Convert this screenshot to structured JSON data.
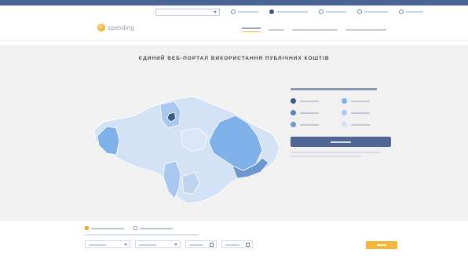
{
  "topbar": {
    "text": ""
  },
  "subnav": {
    "select_label": "",
    "items": [
      {
        "icon": "info-icon",
        "label": ""
      },
      {
        "icon": "user-icon",
        "label": ""
      },
      {
        "icon": "chart-icon",
        "label": ""
      },
      {
        "icon": "list-icon",
        "label": ""
      },
      {
        "icon": "help-icon",
        "label": ""
      }
    ]
  },
  "brand": {
    "name": "spending"
  },
  "mainnav": {
    "items": [
      "",
      "",
      "",
      ""
    ]
  },
  "hero": {
    "title": "ЄДИНИЙ ВЕБ-ПОРТАЛ ВИКОРИСТАННЯ ПУБЛІЧНИХ КОШТІВ"
  },
  "legend": {
    "title": "",
    "items": [
      {
        "color": "#3d5a8c",
        "label": ""
      },
      {
        "color": "#7fb0e8",
        "label": ""
      },
      {
        "color": "#5a82be",
        "label": ""
      },
      {
        "color": "#a9c8ef",
        "label": ""
      },
      {
        "color": "#6d97cf",
        "label": ""
      },
      {
        "color": "#d4e3f5",
        "label": ""
      }
    ],
    "cta_label": "",
    "note": ""
  },
  "filters": {
    "radios": [
      {
        "label": "",
        "checked": true
      },
      {
        "label": "",
        "checked": false
      }
    ],
    "hint": "",
    "fields": [
      "",
      "",
      "",
      ""
    ],
    "search_label": ""
  },
  "colors": {
    "primary": "#4a6595",
    "accent": "#f3b63a",
    "hero_bg": "#f1f1f1"
  }
}
